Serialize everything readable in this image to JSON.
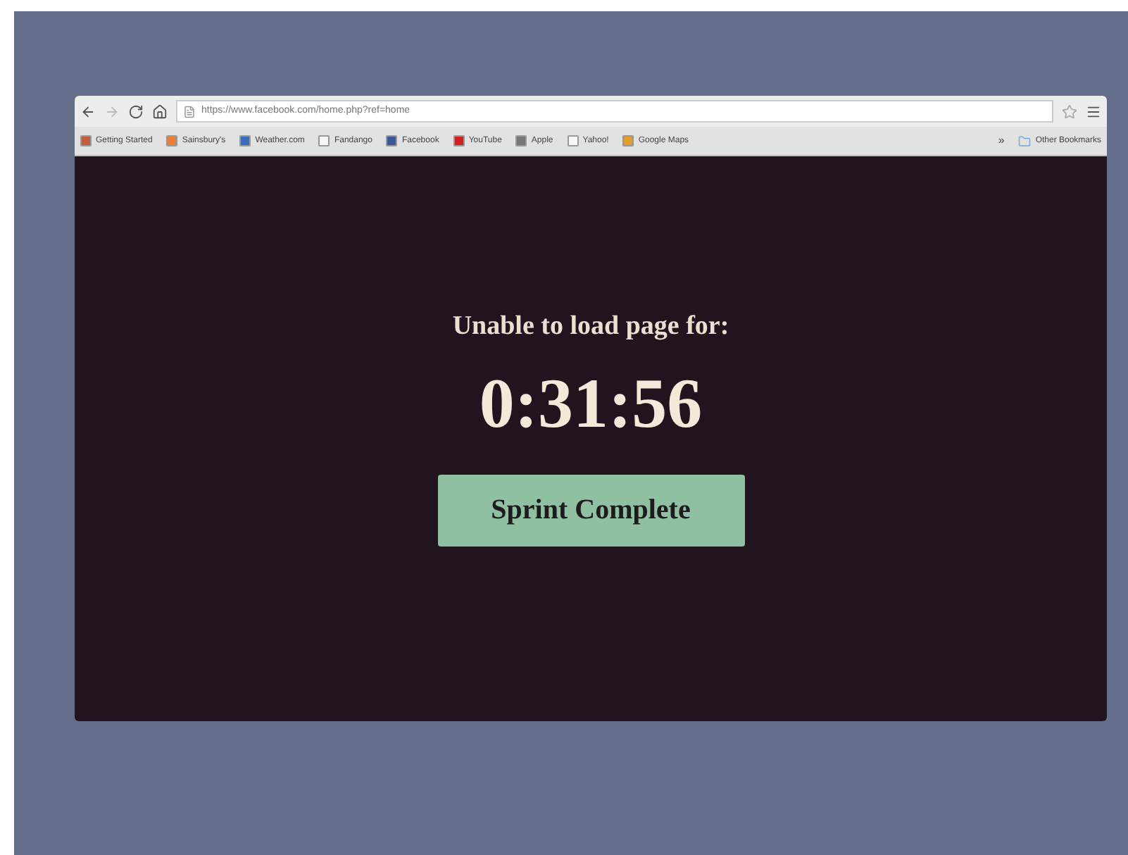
{
  "browser": {
    "url": "https://www.facebook.com/home.php?ref=home",
    "bookmarks": [
      {
        "label": "Getting Started",
        "color": "#c0603a"
      },
      {
        "label": "Sainsbury's",
        "color": "#e8803a"
      },
      {
        "label": "Weather.com",
        "color": "#3a6fc0"
      },
      {
        "label": "Fandango",
        "color": "#f7f7f7"
      },
      {
        "label": "Facebook",
        "color": "#3b5998"
      },
      {
        "label": "YouTube",
        "color": "#d02020"
      },
      {
        "label": "Apple",
        "color": "#777777"
      },
      {
        "label": "Yahoo!",
        "color": "#f7f7f7"
      },
      {
        "label": "Google Maps",
        "color": "#e0a030"
      }
    ],
    "overflow": "»",
    "other_bookmarks": "Other Bookmarks"
  },
  "page": {
    "message": "Unable to load page for:",
    "timer": "0:31:56",
    "button": "Sprint Complete"
  }
}
